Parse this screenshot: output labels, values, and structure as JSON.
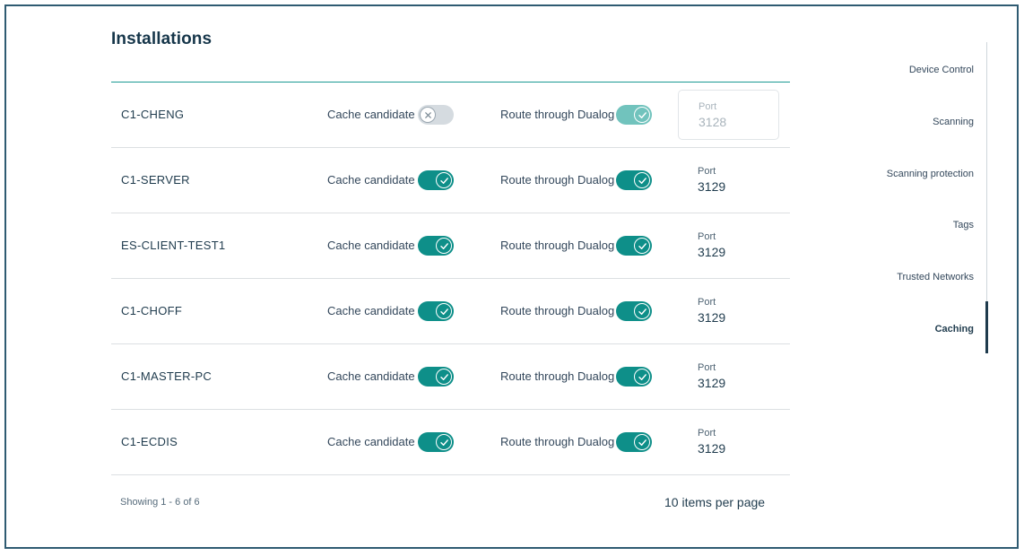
{
  "page": {
    "title": "Installations"
  },
  "installations": [
    {
      "name": "C1-CHENG",
      "cache_label": "Cache candidate",
      "cache_on": false,
      "route_label": "Route through Dualog",
      "route_on": true,
      "route_disabled": true,
      "port_label": "Port",
      "port_value": "3128",
      "port_editable": true
    },
    {
      "name": "C1-SERVER",
      "cache_label": "Cache candidate",
      "cache_on": true,
      "route_label": "Route through Dualog",
      "route_on": true,
      "route_disabled": false,
      "port_label": "Port",
      "port_value": "3129",
      "port_editable": false
    },
    {
      "name": "ES-CLIENT-TEST1",
      "cache_label": "Cache candidate",
      "cache_on": true,
      "route_label": "Route through Dualog",
      "route_on": true,
      "route_disabled": false,
      "port_label": "Port",
      "port_value": "3129",
      "port_editable": false
    },
    {
      "name": "C1-CHOFF",
      "cache_label": "Cache candidate",
      "cache_on": true,
      "route_label": "Route through Dualog",
      "route_on": true,
      "route_disabled": false,
      "port_label": "Port",
      "port_value": "3129",
      "port_editable": false
    },
    {
      "name": "C1-MASTER-PC",
      "cache_label": "Cache candidate",
      "cache_on": true,
      "route_label": "Route through Dualog",
      "route_on": true,
      "route_disabled": false,
      "port_label": "Port",
      "port_value": "3129",
      "port_editable": false
    },
    {
      "name": "C1-ECDIS",
      "cache_label": "Cache candidate",
      "cache_on": true,
      "route_label": "Route through Dualog",
      "route_on": true,
      "route_disabled": false,
      "port_label": "Port",
      "port_value": "3129",
      "port_editable": false
    }
  ],
  "footer": {
    "showing": "Showing 1 - 6 of 6",
    "per_page": "10 items per page"
  },
  "sidenav": {
    "items": [
      {
        "label": "Device Control",
        "active": false
      },
      {
        "label": "Scanning",
        "active": false
      },
      {
        "label": "Scanning protection",
        "active": false
      },
      {
        "label": "Tags",
        "active": false
      },
      {
        "label": "Trusted Networks",
        "active": false
      },
      {
        "label": "Caching",
        "active": true
      }
    ]
  },
  "colors": {
    "accent": "#0e8f89",
    "accent_disabled": "#71c3bd",
    "text_dark": "#1f3b4d",
    "border": "#2f5b72"
  },
  "icons": {
    "toggle_on": "check-icon",
    "toggle_off": "x-icon"
  }
}
